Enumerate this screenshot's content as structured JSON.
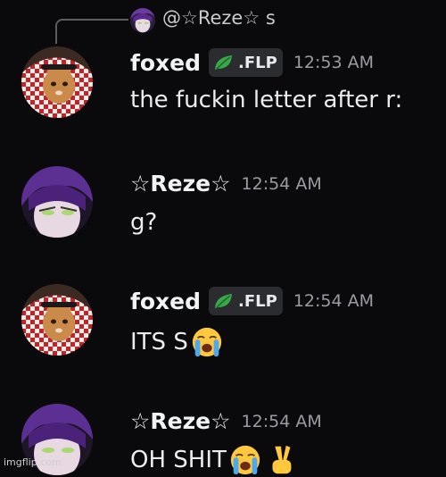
{
  "reply": {
    "text": "@☆Reze☆ s"
  },
  "messages": [
    {
      "author": "foxed",
      "tag": ".FLP",
      "time": "12:53 AM",
      "content": "the fuckin letter after r:"
    },
    {
      "author": "☆Reze☆",
      "time": "12:54 AM",
      "content": "g?"
    },
    {
      "author": "foxed",
      "tag": ".FLP",
      "time": "12:54 AM",
      "content": "ITS S",
      "emoji": [
        "loudly-crying-face"
      ]
    },
    {
      "author": "☆Reze☆",
      "time": "12:54 AM",
      "content": "OH SHIT",
      "emoji": [
        "loudly-crying-face",
        "victory-hand"
      ]
    }
  ],
  "watermark": "imgflip.com",
  "colors": {
    "background": "#0a0a0c",
    "text": "#ececef",
    "timestamp": "#9b9ca3",
    "tag_bg": "#2b2c30",
    "leaf_green": "#3aa84a"
  }
}
